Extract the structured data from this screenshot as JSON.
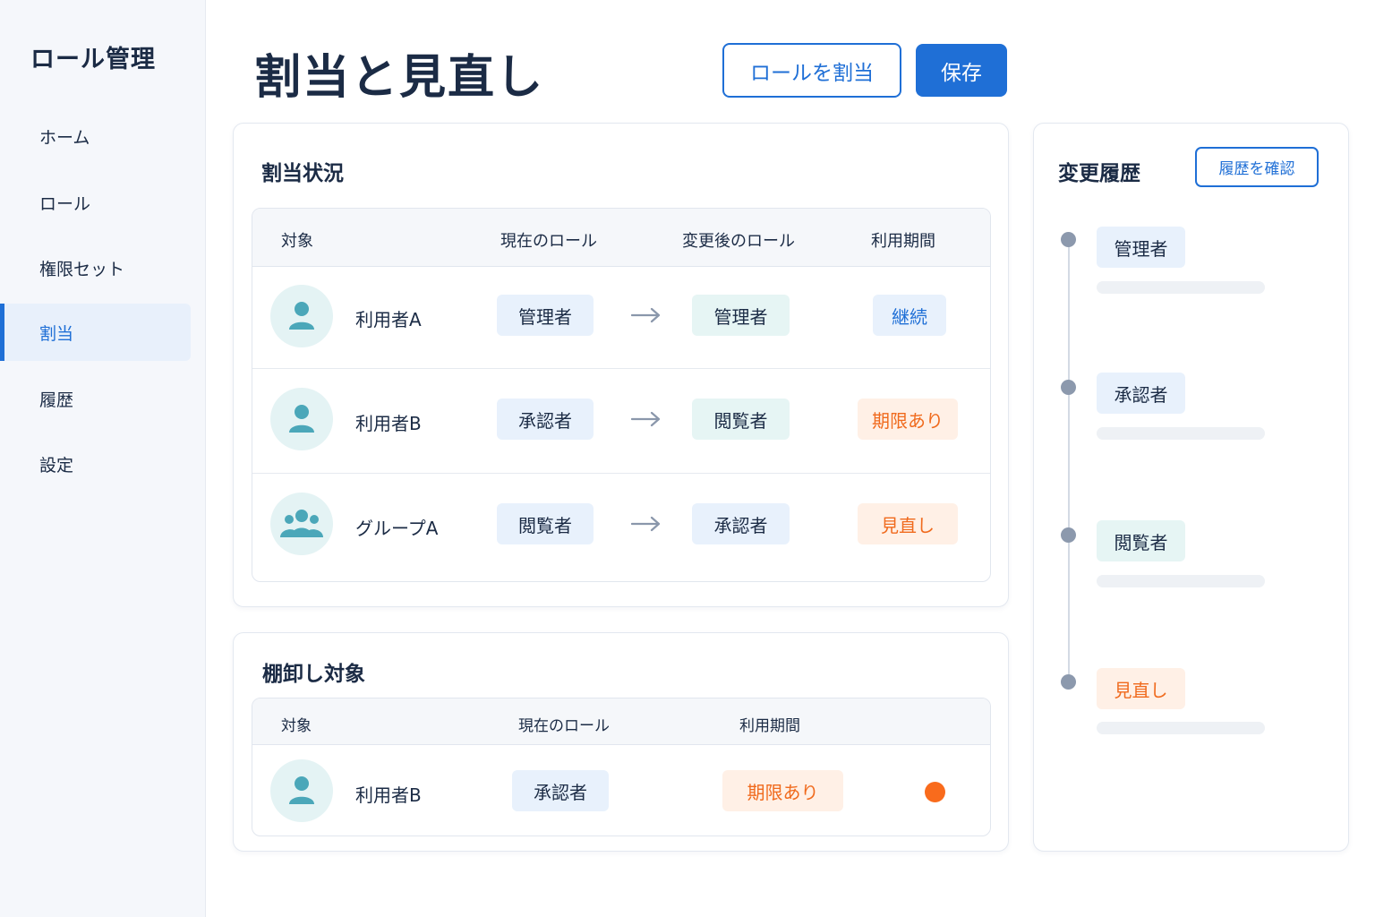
{
  "sidebar": {
    "app_title": "ロール管理",
    "items": [
      {
        "label": "ホーム"
      },
      {
        "label": "ロール"
      },
      {
        "label": "権限セット"
      },
      {
        "label": "割当"
      },
      {
        "label": "履歴"
      },
      {
        "label": "設定"
      }
    ],
    "active_item": "割当"
  },
  "header": {
    "title": "割当と見直し",
    "assign_button": "ロールを割当",
    "save_button": "保存"
  },
  "assignment": {
    "title": "割当状況",
    "columns": [
      "対象",
      "現在のロール",
      "変更後のロール",
      "利用期間"
    ],
    "rows": [
      {
        "target": "利用者A",
        "type": "user",
        "current": "管理者",
        "after": "管理者",
        "period": "継続",
        "period_style": "blue"
      },
      {
        "target": "利用者B",
        "type": "user",
        "current": "承認者",
        "after": "閲覧者",
        "period": "期限あり",
        "period_style": "orange"
      },
      {
        "target": "グループA",
        "type": "group",
        "current": "閲覧者",
        "after": "承認者",
        "period": "見直し",
        "period_style": "orange"
      }
    ]
  },
  "review": {
    "title": "棚卸し対象",
    "columns": [
      "対象",
      "現在のロール",
      "利用期間"
    ],
    "rows": [
      {
        "target": "利用者B",
        "current": "承認者",
        "period": "期限あり"
      }
    ]
  },
  "history": {
    "title": "変更履歴",
    "button": "履歴を確認",
    "entries": [
      {
        "label": "管理者",
        "style": "blue"
      },
      {
        "label": "承認者",
        "style": "blue"
      },
      {
        "label": "閲覧者",
        "style": "teal"
      },
      {
        "label": "見直し",
        "style": "orange"
      }
    ]
  },
  "colors": {
    "accent": "#1f6fd6",
    "warning": "#f06a1d",
    "text": "#1b2b45"
  }
}
